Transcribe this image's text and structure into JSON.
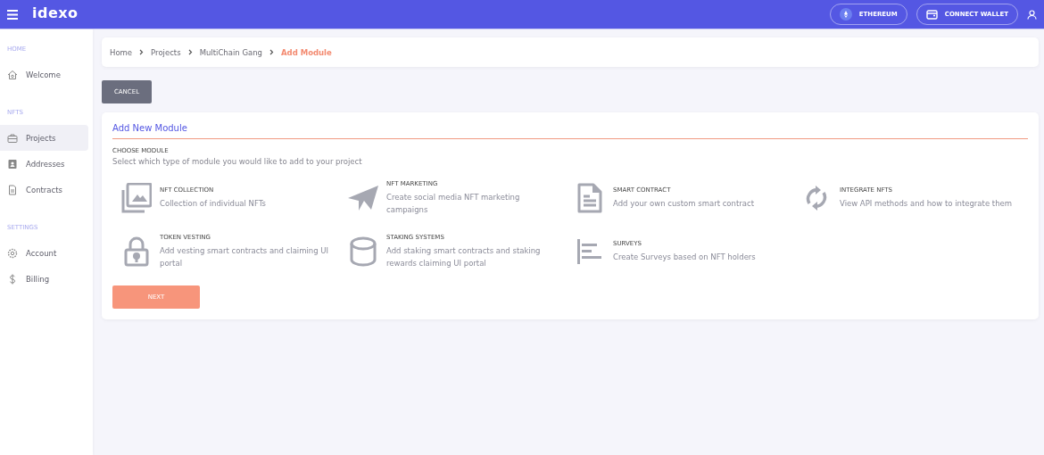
{
  "topbar": {
    "logo": "idexo",
    "network_button": "ETHEREUM",
    "wallet_button": "CONNECT WALLET"
  },
  "sidebar": {
    "sections": [
      {
        "heading": "HOME",
        "items": [
          {
            "label": "Welcome",
            "kind": "home",
            "selected": false
          }
        ]
      },
      {
        "heading": "NFTS",
        "items": [
          {
            "label": "Projects",
            "kind": "briefcase",
            "selected": true
          },
          {
            "label": "Addresses",
            "kind": "contact",
            "selected": false
          },
          {
            "label": "Contracts",
            "kind": "file",
            "selected": false
          }
        ]
      },
      {
        "heading": "SETTINGS",
        "items": [
          {
            "label": "Account",
            "kind": "gear",
            "selected": false
          },
          {
            "label": "Billing",
            "kind": "dollar",
            "selected": false
          }
        ]
      }
    ]
  },
  "breadcrumb": [
    {
      "label": "Home",
      "current": false
    },
    {
      "label": "Projects",
      "current": false
    },
    {
      "label": "MultiChain Gang",
      "current": false
    },
    {
      "label": "Add Module",
      "current": true
    }
  ],
  "cancel_button": "CANCEL",
  "card": {
    "title": "Add New Module",
    "section_label": "CHOOSE MODULE",
    "instructions": "Select which type of module you would like to add to your project",
    "modules": [
      {
        "kind": "images",
        "title": "NFT COLLECTION",
        "description": "Collection of individual NFTs"
      },
      {
        "kind": "plane",
        "title": "NFT MARKETING",
        "description": "Create social media NFT marketing campaigns"
      },
      {
        "kind": "document",
        "title": "SMART CONTRACT",
        "description": "Add your own custom smart contract"
      },
      {
        "kind": "sync",
        "title": "INTEGRATE NFTS",
        "description": "View API methods and how to integrate them"
      },
      {
        "kind": "lock",
        "title": "TOKEN VESTING",
        "description": "Add vesting smart contracts and claiming UI portal"
      },
      {
        "kind": "database",
        "title": "STAKING SYSTEMS",
        "description": "Add staking smart contracts and staking rewards claiming UI portal"
      },
      {
        "kind": "bars",
        "title": "SURVEYS",
        "description": "Create Surveys based on NFT holders"
      }
    ],
    "next_button": "NEXT"
  }
}
